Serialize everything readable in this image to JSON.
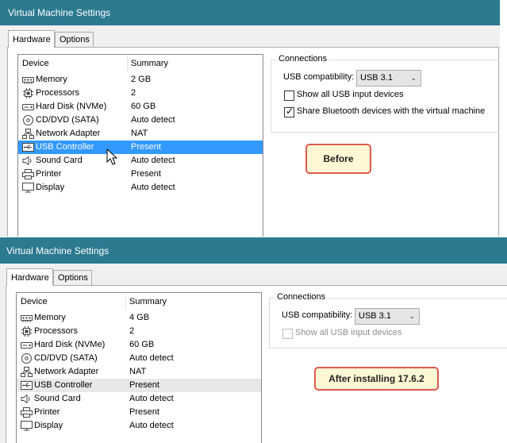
{
  "before": {
    "window_title": "Virtual Machine Settings",
    "tabs": [
      {
        "label": "Hardware",
        "active": true
      },
      {
        "label": "Options",
        "active": false
      }
    ],
    "columns": {
      "device": "Device",
      "summary": "Summary"
    },
    "devices": [
      {
        "name": "Memory",
        "summary": "2 GB",
        "icon": "memory-icon"
      },
      {
        "name": "Processors",
        "summary": "2",
        "icon": "processor-icon"
      },
      {
        "name": "Hard Disk (NVMe)",
        "summary": "60 GB",
        "icon": "hard-disk-icon"
      },
      {
        "name": "CD/DVD (SATA)",
        "summary": "Auto detect",
        "icon": "cd-dvd-icon"
      },
      {
        "name": "Network Adapter",
        "summary": "NAT",
        "icon": "network-adapter-icon"
      },
      {
        "name": "USB Controller",
        "summary": "Present",
        "icon": "usb-icon",
        "selected": true
      },
      {
        "name": "Sound Card",
        "summary": "Auto detect",
        "icon": "speaker-icon"
      },
      {
        "name": "Printer",
        "summary": "Present",
        "icon": "printer-icon"
      },
      {
        "name": "Display",
        "summary": "Auto detect",
        "icon": "display-icon"
      }
    ],
    "connections": {
      "title": "Connections",
      "usb_compat_label": "USB compatibility:",
      "usb_compat_value": "USB 3.1",
      "show_all_usb_label": "Show all USB input devices",
      "show_all_usb_checked": false,
      "share_bluetooth_label": "Share Bluetooth devices with the virtual machine",
      "share_bluetooth_checked": true
    },
    "callout": "Before"
  },
  "after": {
    "window_title": "Virtual Machine Settings",
    "tabs": [
      {
        "label": "Hardware",
        "active": true
      },
      {
        "label": "Options",
        "active": false
      }
    ],
    "columns": {
      "device": "Device",
      "summary": "Summary"
    },
    "devices": [
      {
        "name": "Memory",
        "summary": "4 GB",
        "icon": "memory-icon"
      },
      {
        "name": "Processors",
        "summary": "2",
        "icon": "processor-icon"
      },
      {
        "name": "Hard Disk (NVMe)",
        "summary": "60 GB",
        "icon": "hard-disk-icon"
      },
      {
        "name": "CD/DVD (SATA)",
        "summary": "Auto detect",
        "icon": "cd-dvd-icon"
      },
      {
        "name": "Network Adapter",
        "summary": "NAT",
        "icon": "network-adapter-icon"
      },
      {
        "name": "USB Controller",
        "summary": "Present",
        "icon": "usb-icon",
        "hover": true
      },
      {
        "name": "Sound Card",
        "summary": "Auto detect",
        "icon": "speaker-icon"
      },
      {
        "name": "Printer",
        "summary": "Present",
        "icon": "printer-icon"
      },
      {
        "name": "Display",
        "summary": "Auto detect",
        "icon": "display-icon"
      }
    ],
    "connections": {
      "title": "Connections",
      "usb_compat_label": "USB compatibility:",
      "usb_compat_value": "USB 3.1",
      "show_all_usb_label": "Show all USB input devices",
      "show_all_usb_checked": false,
      "show_all_usb_disabled": true
    },
    "callout": "After installing 17.6.2"
  },
  "colors": {
    "titlebar": "#2b7a90",
    "selection": "#3399ff",
    "callout_border": "#e05a4f",
    "callout_fill": "#fff8d4"
  }
}
